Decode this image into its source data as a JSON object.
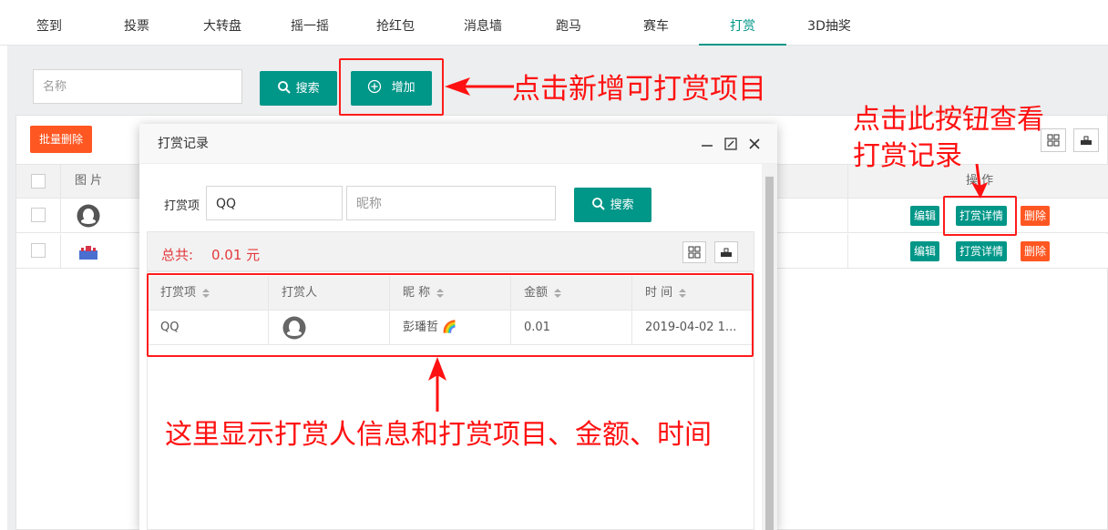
{
  "tabs": [
    "签到",
    "投票",
    "大转盘",
    "摇一摇",
    "抢红包",
    "消息墙",
    "跑马",
    "赛车",
    "打赏",
    "3D抽奖"
  ],
  "active_tab": "打赏",
  "toolbar": {
    "search_placeholder": "名称",
    "search_label": "搜索",
    "add_label": "增加",
    "bulk_delete_label": "批量删除"
  },
  "table": {
    "headers": {
      "image": "图 片",
      "actions": "操 作"
    },
    "actions": {
      "edit": "编辑",
      "details": "打赏详情",
      "delete": "删除"
    }
  },
  "modal": {
    "title": "打赏记录",
    "filter_label": "打赏项",
    "filter_value": "QQ",
    "nickname_placeholder": "昵称",
    "search_label": "搜索",
    "total_label": "总共:",
    "total_value": "0.01 元",
    "columns": [
      "打赏项",
      "打赏人",
      "昵 称",
      "金额",
      "时 间"
    ],
    "rows": [
      {
        "item": "QQ",
        "nickname": "彭璠哲 🌈",
        "amount": "0.01",
        "time": "2019-04-02 1..."
      }
    ]
  },
  "annotations": {
    "add": "点击新增可打赏项目",
    "details_line1": "点击此按钮查看",
    "details_line2": "打赏记录",
    "records": "这里显示打赏人信息和打赏项目、金额、时间"
  },
  "colors": {
    "primary": "#009688",
    "danger": "#ff5722",
    "annotation": "#ff1111"
  }
}
